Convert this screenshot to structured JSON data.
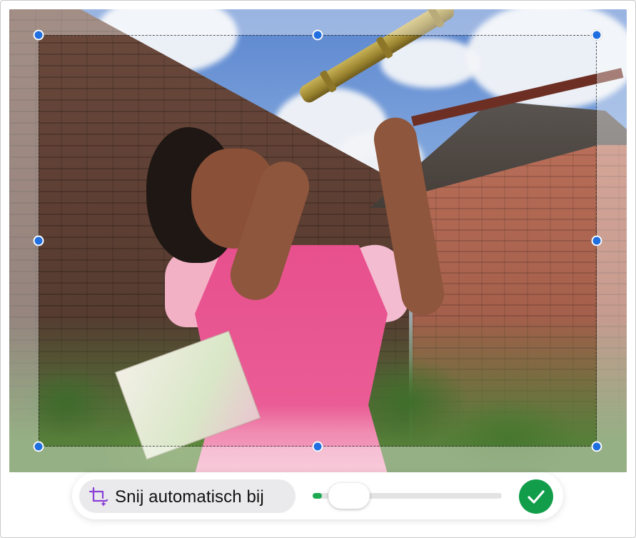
{
  "photo": {
    "description_icon": "photo-content",
    "crop_handles": [
      "top-left",
      "top-center",
      "top-right",
      "middle-left",
      "middle-right",
      "bottom-left",
      "bottom-center",
      "bottom-right"
    ]
  },
  "toolbar": {
    "auto_crop_label": "Snij automatisch bij",
    "auto_crop_icon": "crop-sparkle-icon",
    "slider": {
      "value": 0.05,
      "fill_color": "#1eaa52"
    },
    "confirm_icon": "checkmark-icon",
    "confirm_color": "#119d4a"
  },
  "colors": {
    "handle": "#1f6fe0",
    "accent_green": "#119d4a"
  }
}
